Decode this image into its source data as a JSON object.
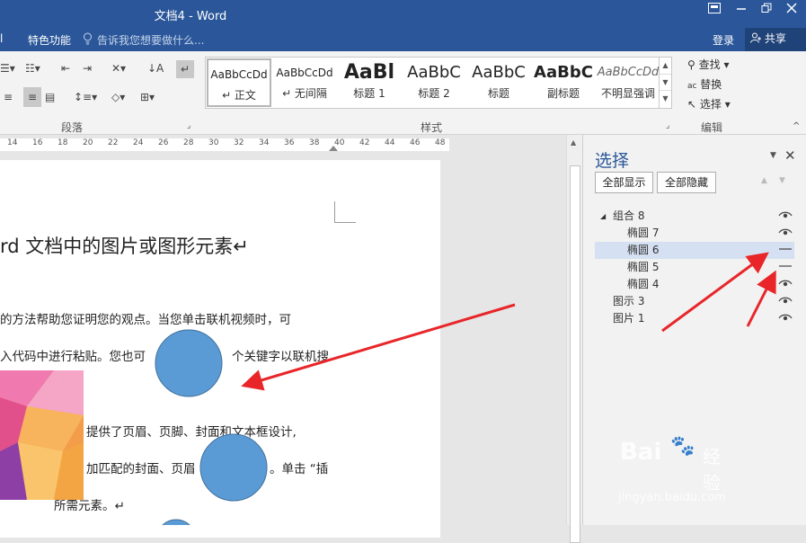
{
  "titlebar": {
    "doc_title": "文档4 - Word",
    "ribbon_display_icon": "ribbon-display-options-icon",
    "minimize_icon": "minimize-icon",
    "restore_icon": "restore-icon",
    "close_icon": "close-icon"
  },
  "tabs": {
    "special_features": "特色功能",
    "tell_me_placeholder": "告诉我您想要做什么...",
    "sign_in": "登录",
    "share": "共享"
  },
  "ribbon": {
    "paragraph_label": "段落",
    "styles_label": "样式",
    "editing_label": "编辑",
    "styles": [
      {
        "preview": "AaBbCcDd",
        "name": "↵ 正文"
      },
      {
        "preview": "AaBbCcDd",
        "name": "↵ 无间隔"
      },
      {
        "preview": "AaBl",
        "name": "标题 1"
      },
      {
        "preview": "AaBbC",
        "name": "标题 2"
      },
      {
        "preview": "AaBbC",
        "name": "标题"
      },
      {
        "preview": "AaBbC",
        "name": "副标题"
      },
      {
        "preview": "AaBbCcDd",
        "name": "不明显强调"
      }
    ],
    "editing": {
      "find": "查找",
      "replace": "替换",
      "select": "选择"
    }
  },
  "ruler": {
    "ticks": [
      "14",
      "16",
      "18",
      "20",
      "22",
      "24",
      "26",
      "28",
      "30",
      "32",
      "34",
      "36",
      "38",
      "40",
      "42",
      "44",
      "46",
      "48"
    ]
  },
  "document": {
    "heading": "rd 文档中的图片或图形元素↵",
    "paragraphs": [
      "的方法帮助您证明您的观点。当您单击联机视频时，可",
      "入代码中进行粘贴。您也可",
      "个关键字以联机搜",
      "提供了页眉、页脚、封面和文本框设计,",
      "加匹配的封面、页眉",
      "。单击 “插",
      "所需元素。↵"
    ]
  },
  "selection_pane": {
    "title": "选择",
    "show_all": "全部显示",
    "hide_all": "全部隐藏",
    "objects": [
      {
        "name": "组合 8",
        "level": 0,
        "expanded": true,
        "visible": true,
        "selected": false
      },
      {
        "name": "椭圆 7",
        "level": 1,
        "visible": true,
        "selected": false
      },
      {
        "name": "椭圆 6",
        "level": 1,
        "visible": false,
        "selected": true
      },
      {
        "name": "椭圆 5",
        "level": 1,
        "visible": false,
        "selected": false
      },
      {
        "name": "椭圆 4",
        "level": 1,
        "visible": true,
        "selected": false
      },
      {
        "name": "图示 3",
        "level": 0,
        "visible": true,
        "selected": false
      },
      {
        "name": "图片 1",
        "level": 0,
        "visible": true,
        "selected": false
      }
    ]
  },
  "watermark": {
    "brand": "Bai",
    "brand_cn": "经验",
    "url": "jingyan.baidu.com"
  },
  "colors": {
    "accent": "#2b579a",
    "circle_fill": "#5b9bd5",
    "arrow": "#e8262a"
  }
}
